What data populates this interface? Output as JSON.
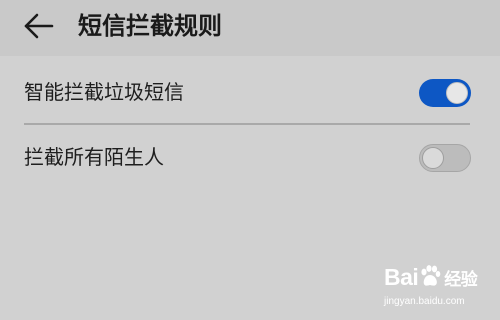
{
  "header": {
    "back_icon": "arrow-left-icon",
    "title": "短信拦截规则"
  },
  "settings": [
    {
      "label": "智能拦截垃圾短信",
      "enabled": true
    },
    {
      "label": "拦截所有陌生人",
      "enabled": false
    }
  ],
  "watermark": {
    "brand_prefix": "Bai",
    "brand_suffix": "经验",
    "url": "jingyan.baidu.com"
  },
  "colors": {
    "toggle_on": "#0d57c4",
    "toggle_off": "#bcbcbc",
    "background": "#d1d1d1"
  }
}
